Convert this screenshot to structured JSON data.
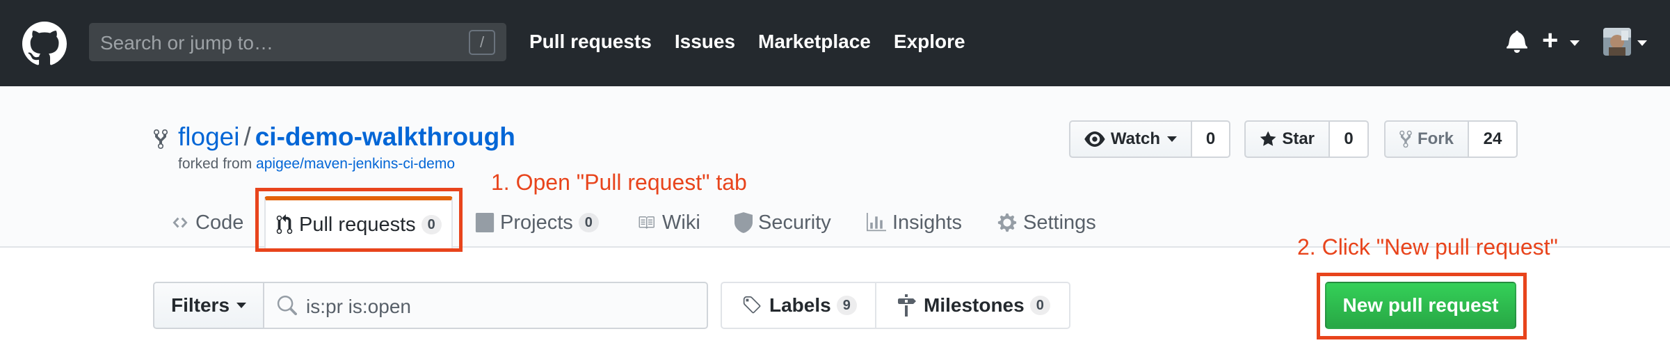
{
  "header": {
    "search_placeholder": "Search or jump to…",
    "search_key": "/",
    "nav": [
      "Pull requests",
      "Issues",
      "Marketplace",
      "Explore"
    ],
    "plus": "+",
    "icons": [
      "github-logo",
      "bell-icon",
      "plus-icon",
      "avatar"
    ]
  },
  "repo": {
    "owner": "flogei",
    "separator": "/",
    "name": "ci-demo-walkthrough",
    "forked_prefix": "forked from ",
    "forked_source": "apigee/maven-jenkins-ci-demo",
    "watch": {
      "label": "Watch",
      "count": "0"
    },
    "star": {
      "label": "Star",
      "count": "0"
    },
    "fork": {
      "label": "Fork",
      "count": "24"
    }
  },
  "tabs": {
    "code": "Code",
    "pulls": "Pull requests",
    "pulls_count": "0",
    "projects": "Projects",
    "projects_count": "0",
    "wiki": "Wiki",
    "security": "Security",
    "insights": "Insights",
    "settings": "Settings"
  },
  "subnav": {
    "filters": "Filters",
    "query": "is:pr is:open",
    "labels": "Labels",
    "labels_count": "9",
    "milestones": "Milestones",
    "milestones_count": "0",
    "new_pr": "New pull request"
  },
  "annotations": {
    "step1": "1. Open \"Pull request\" tab",
    "step2": "2. Click \"New pull request\"",
    "color": "#e8441c"
  },
  "colors": {
    "header_bg": "#24292e",
    "link": "#0366d6",
    "tab_accent": "#e36209",
    "green": "#28a745"
  }
}
